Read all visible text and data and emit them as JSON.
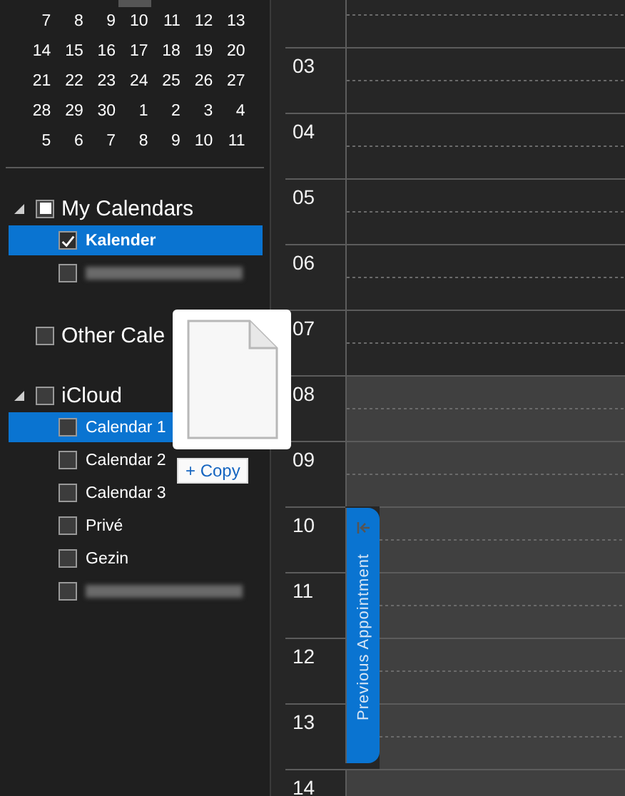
{
  "mini_calendar": {
    "weeks": [
      [
        "7",
        "8",
        "9",
        "10",
        "11",
        "12",
        "13"
      ],
      [
        "14",
        "15",
        "16",
        "17",
        "18",
        "19",
        "20"
      ],
      [
        "21",
        "22",
        "23",
        "24",
        "25",
        "26",
        "27"
      ],
      [
        "28",
        "29",
        "30",
        "1",
        "2",
        "3",
        "4"
      ],
      [
        "5",
        "6",
        "7",
        "8",
        "9",
        "10",
        "11"
      ]
    ]
  },
  "calendar_groups": [
    {
      "name": "My Calendars",
      "expanded": true,
      "indeterminate": true,
      "items": [
        {
          "kind": "calendar",
          "label": "Kalender",
          "checked": true,
          "selected": true
        },
        {
          "kind": "redacted",
          "checked": false,
          "selected": false
        }
      ]
    },
    {
      "name": "Other Cale",
      "checked": false
    },
    {
      "name": "iCloud",
      "expanded": true,
      "checked": false,
      "items": [
        {
          "kind": "calendar",
          "label": "Calendar 1",
          "checked": false,
          "selected": true
        },
        {
          "kind": "calendar",
          "label": "Calendar 2",
          "checked": false,
          "selected": false
        },
        {
          "kind": "calendar",
          "label": "Calendar 3",
          "checked": false,
          "selected": false
        },
        {
          "kind": "calendar",
          "label": "Privé",
          "checked": false,
          "selected": false
        },
        {
          "kind": "calendar",
          "label": "Gezin",
          "checked": false,
          "selected": false
        },
        {
          "kind": "redacted",
          "checked": false,
          "selected": false
        }
      ]
    }
  ],
  "hours": [
    {
      "working": false
    },
    {
      "label": "03",
      "working": false
    },
    {
      "label": "04",
      "working": false
    },
    {
      "label": "05",
      "working": false
    },
    {
      "label": "06",
      "working": false
    },
    {
      "label": "07",
      "working": false
    },
    {
      "label": "08",
      "working": true
    },
    {
      "label": "09",
      "working": true
    },
    {
      "label": "10",
      "working": true
    },
    {
      "label": "11",
      "working": true
    },
    {
      "label": "12",
      "working": true
    },
    {
      "label": "13",
      "working": true
    },
    {
      "label": "14",
      "working": true
    }
  ],
  "previous_appointment": "Previous Appointment",
  "drag": {
    "action": "+ Copy"
  }
}
